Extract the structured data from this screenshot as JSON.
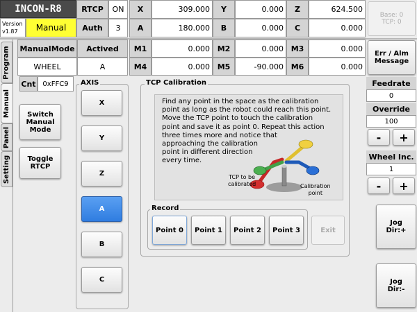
{
  "header": {
    "title": "INCON-R8",
    "version": "Version v1.87",
    "mode": "Manual",
    "rtcp_label": "RTCP",
    "rtcp_value": "ON",
    "auth_label": "Auth",
    "auth_value": "3",
    "manualmode_label": "ManualMode",
    "manualmode_value": "WHEEL",
    "actived_label": "Actived",
    "actived_value": "A",
    "cnt_label": "Cnt",
    "cnt_value": "0xFFC9"
  },
  "coords": [
    {
      "label": "X",
      "value": "309.000"
    },
    {
      "label": "Y",
      "value": "0.000"
    },
    {
      "label": "Z",
      "value": "624.500"
    },
    {
      "label": "A",
      "value": "180.000"
    },
    {
      "label": "B",
      "value": "0.000"
    },
    {
      "label": "C",
      "value": "0.000"
    }
  ],
  "motors": [
    {
      "label": "M1",
      "value": "0.000"
    },
    {
      "label": "M2",
      "value": "0.000"
    },
    {
      "label": "M3",
      "value": "0.000"
    },
    {
      "label": "M4",
      "value": "0.000"
    },
    {
      "label": "M5",
      "value": "-90.000"
    },
    {
      "label": "M6",
      "value": "0.000"
    }
  ],
  "base_tcp": {
    "base": "Base: 0",
    "tcp": "TCP: 0"
  },
  "err_button": {
    "line1": "Err / Alm",
    "line2": "Message"
  },
  "feedrate": {
    "label": "Feedrate",
    "value": "0"
  },
  "override": {
    "label": "Override",
    "value": "100",
    "minus": "-",
    "plus": "+"
  },
  "wheel_inc": {
    "label": "Wheel Inc.",
    "value": "1",
    "minus": "-",
    "plus": "+"
  },
  "jog_plus": {
    "line1": "Jog",
    "line2": "Dir:+"
  },
  "jog_minus": {
    "line1": "Jog",
    "line2": "Dir:-"
  },
  "tabs": [
    "Program",
    "Manual",
    "Panel",
    "Setting"
  ],
  "left_buttons": {
    "switch": {
      "line1": "Switch",
      "line2": "Manual",
      "line3": "Mode"
    },
    "toggle": {
      "line1": "Toggle",
      "line2": "RTCP"
    }
  },
  "axis": {
    "label": "AXIS",
    "items": [
      "X",
      "Y",
      "Z",
      "A",
      "B",
      "C"
    ],
    "selected": "A"
  },
  "tcp": {
    "title": "TCP Calibration",
    "instructions": [
      "Find any point in the space as the calibration",
      "point as long as the robot could reach this point.",
      "Move the TCP point to touch the calibration",
      "point and save it as point 0. Repeat this action",
      "three times more and notice that",
      "approaching the calibration",
      "point in different direction",
      "every time."
    ],
    "callout_tcp1": "TCP to be",
    "callout_tcp2": "calibrated",
    "callout_cal1": "Calibration",
    "callout_cal2": "point",
    "record_label": "Record",
    "points": [
      "Point 0",
      "Point 1",
      "Point 2",
      "Point 3"
    ],
    "exit": "Exit"
  }
}
